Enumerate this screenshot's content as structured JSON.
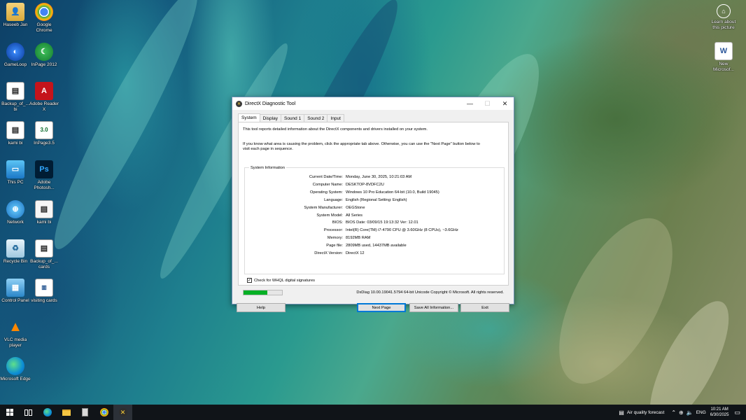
{
  "desktop": {
    "icons": [
      {
        "label": "Haseeb Jan",
        "icon": "user-folder-icon"
      },
      {
        "label": "Google Chrome",
        "icon": "chrome-icon"
      },
      {
        "label": "GameLoop",
        "icon": "gameloop-icon"
      },
      {
        "label": "InPage 2012",
        "icon": "inpage-icon"
      },
      {
        "label": "Backup_of_... bi",
        "icon": "file-shortcut-icon"
      },
      {
        "label": "Adobe Reader X",
        "icon": "adobe-reader-icon"
      },
      {
        "label": "kami bi",
        "icon": "file-shortcut-icon"
      },
      {
        "label": "InPage3.5",
        "icon": "inpage-icon"
      },
      {
        "label": "This PC",
        "icon": "this-pc-icon"
      },
      {
        "label": "Adobe Photosh...",
        "icon": "photoshop-icon"
      },
      {
        "label": "Network",
        "icon": "network-icon"
      },
      {
        "label": "kami bi",
        "icon": "file-shortcut-icon"
      },
      {
        "label": "Recycle Bin",
        "icon": "recycle-bin-icon"
      },
      {
        "label": "Backup_of_... cards",
        "icon": "file-shortcut-icon"
      },
      {
        "label": "Control Panel",
        "icon": "control-panel-icon"
      },
      {
        "label": "visiting cards",
        "icon": "image-file-icon"
      },
      {
        "label": "VLC media player",
        "icon": "vlc-icon"
      },
      {
        "label": "Microsoft Edge",
        "icon": "edge-icon"
      }
    ],
    "right_icons": [
      {
        "label": "Learn about this picture",
        "icon": "learn-picture-icon"
      },
      {
        "label": "New Microsof...",
        "icon": "word-document-icon"
      }
    ]
  },
  "window": {
    "title": "DirectX Diagnostic Tool",
    "tabs": [
      "System",
      "Display",
      "Sound 1",
      "Sound 2",
      "Input"
    ],
    "active_tab": "System",
    "intro_text": "This tool reports detailed information about the DirectX components and drivers installed on your system.",
    "help_text_line1": "If you know what area is causing the problem, click the appropriate tab above.  Otherwise, you can use the \"Next Page\" button below to",
    "help_text_line2": "visit each page in sequence.",
    "group_title": "System Information",
    "system_info": [
      {
        "key": "Current Date/Time:",
        "value": "Monday, June 30, 2025, 10:21:03 AM"
      },
      {
        "key": "Computer Name:",
        "value": "DESKTOP-8VDFC2U"
      },
      {
        "key": "Operating System:",
        "value": "Windows 10 Pro Education 64-bit (10.0, Build 19045)"
      },
      {
        "key": "Language:",
        "value": "English (Regional Setting: English)"
      },
      {
        "key": "System Manufacturer:",
        "value": "OEGStone"
      },
      {
        "key": "System Model:",
        "value": "All Series"
      },
      {
        "key": "BIOS:",
        "value": "BIOS Date: 03/09/15 19:13:32 Ver: 12.01"
      },
      {
        "key": "Processor:",
        "value": "Intel(R) Core(TM) i7-4790 CPU @ 3.60GHz (8 CPUs), ~3.6GHz"
      },
      {
        "key": "Memory:",
        "value": "8192MB RAM"
      },
      {
        "key": "Page file:",
        "value": "2809MB used, 14437MB available"
      },
      {
        "key": "DirectX Version:",
        "value": "DirectX 12"
      }
    ],
    "whql_label": "Check for WHQL digital signatures",
    "whql_checked": true,
    "progress": 0.62,
    "version_text": "DxDiag 10.00.19041.5794 64-bit Unicode  Copyright © Microsoft. All rights reserved.",
    "buttons": {
      "help": "Help",
      "next_page": "Next Page",
      "save_all": "Save All Information...",
      "exit": "Exit"
    }
  },
  "taskbar": {
    "items": [
      "windows-start-icon",
      "task-view-icon",
      "edge-icon",
      "file-explorer-icon",
      "calculator-icon",
      "chrome-icon",
      "dxdiag-icon"
    ],
    "weather": "Air quality forecast",
    "language": "ENG",
    "time": "10:21 AM",
    "date": "6/30/2025"
  }
}
